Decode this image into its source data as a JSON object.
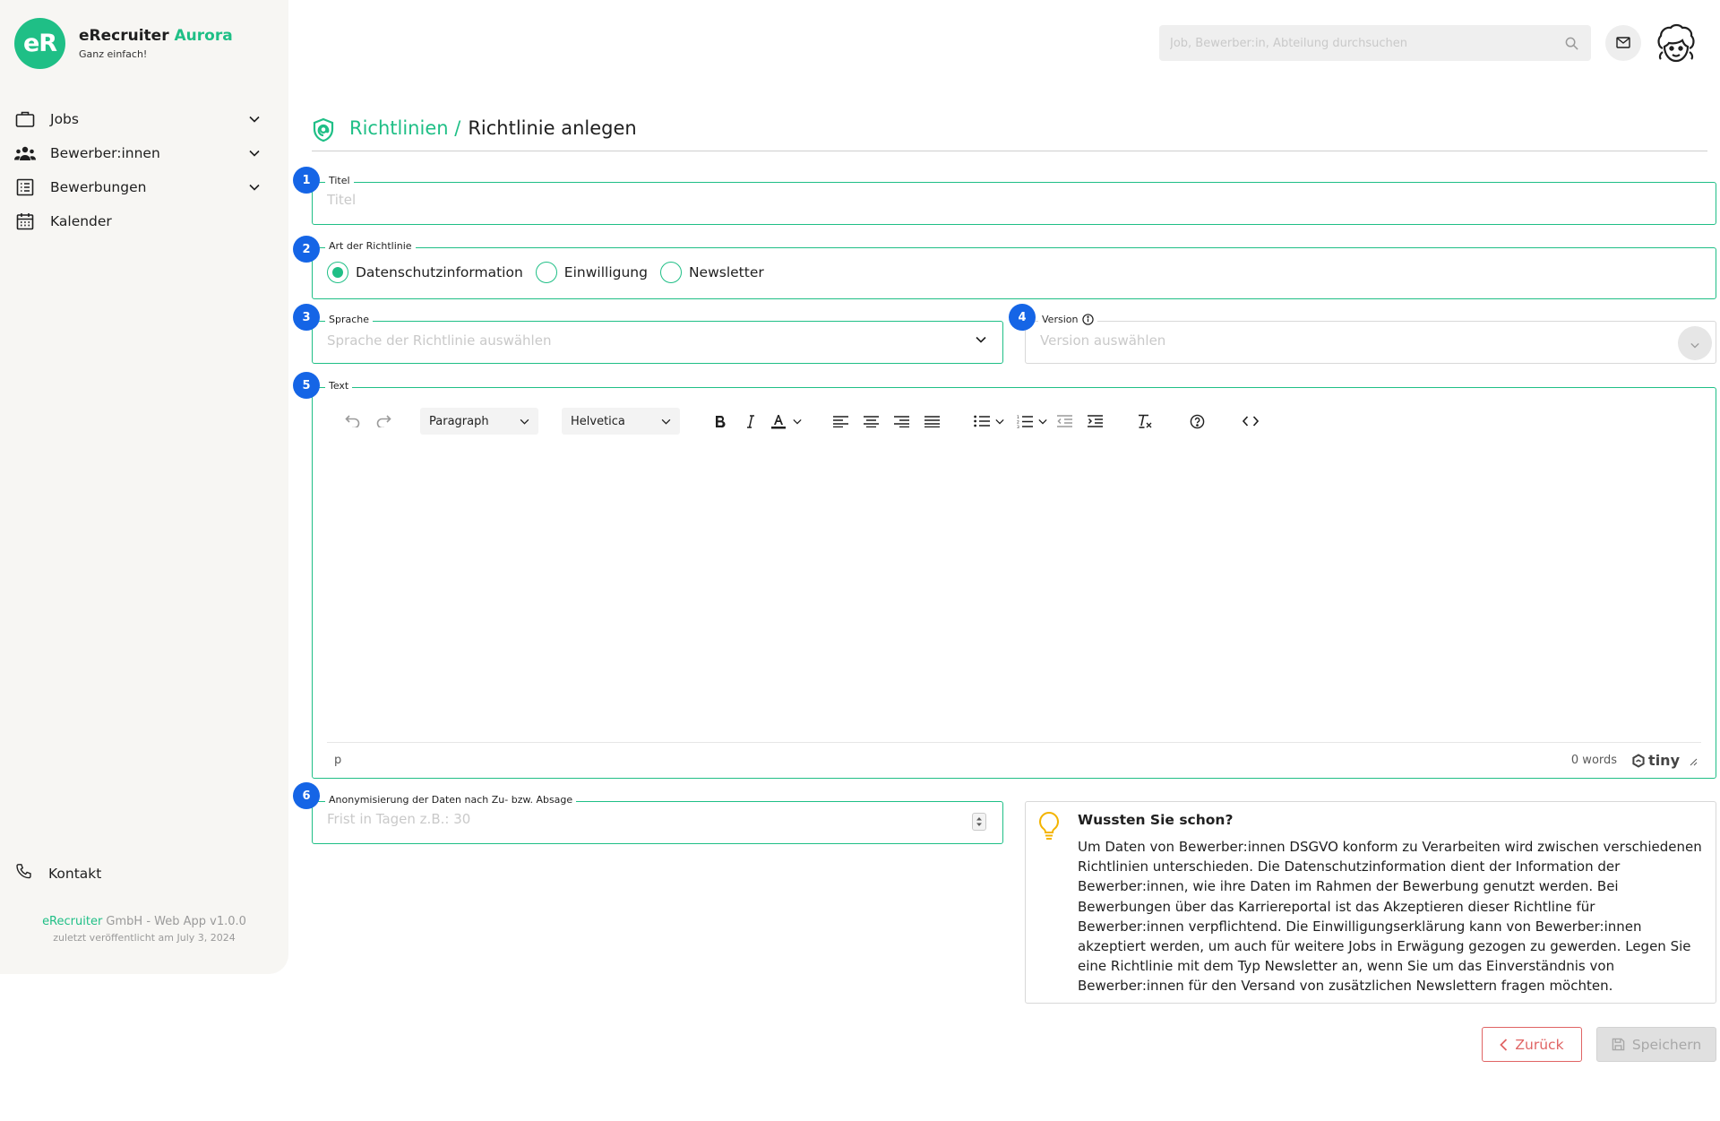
{
  "brand": {
    "logo_text": "eR",
    "name": "eRecruiter",
    "name_accent": "Aurora",
    "tagline": "Ganz einfach!"
  },
  "sidebar": {
    "items": [
      {
        "label": "Jobs",
        "icon": "briefcase-icon",
        "has_chevron": true
      },
      {
        "label": "Bewerber:innen",
        "icon": "people-icon",
        "has_chevron": true
      },
      {
        "label": "Bewerbungen",
        "icon": "list-icon",
        "has_chevron": true
      },
      {
        "label": "Kalender",
        "icon": "calendar-icon",
        "has_chevron": false
      }
    ],
    "contact_label": "Kontakt",
    "footer_brand": "eRecruiter",
    "footer_rest": " GmbH - Web App v1.0.0",
    "footer_published": "zuletzt veröffentlicht am July 3, 2024"
  },
  "topbar": {
    "search_placeholder": "Job, Bewerber:in, Abteilung durchsuchen"
  },
  "header": {
    "breadcrumb": "Richtlinien /",
    "title": "Richtlinie anlegen"
  },
  "form": {
    "titel": {
      "badge": "1",
      "legend": "Titel",
      "placeholder": "Titel",
      "value": ""
    },
    "art": {
      "badge": "2",
      "legend": "Art der Richtlinie",
      "options": [
        {
          "label": "Datenschutzinformation",
          "selected": true
        },
        {
          "label": "Einwilligung",
          "selected": false
        },
        {
          "label": "Newsletter",
          "selected": false
        }
      ]
    },
    "sprache": {
      "badge": "3",
      "legend": "Sprache",
      "placeholder": "Sprache der Richtlinie auswählen"
    },
    "version": {
      "badge": "4",
      "legend": "Version",
      "placeholder": "Version auswählen"
    },
    "text": {
      "badge": "5",
      "legend": "Text",
      "block_format": "Paragraph",
      "font_family": "Helvetica",
      "status_path": "p",
      "word_count": "0 words",
      "brand": "tiny"
    },
    "anonymisierung": {
      "badge": "6",
      "legend": "Anonymisierung der Daten nach Zu- bzw. Absage",
      "placeholder": "Frist in Tagen z.B.: 30"
    }
  },
  "info": {
    "title": "Wussten Sie schon?",
    "text": "Um Daten von Bewerber:innen DSGVO konform zu Verarbeiten wird zwischen verschiedenen Richtlinien unterschieden. Die Datenschutzinformation dient der Information der Bewerber:innen, wie ihre Daten im Rahmen der Bewerbung genutzt werden. Bei Bewerbungen über das Karriereportal ist das Akzeptieren dieser Richtline für Bewerber:innen verpflichtend. Die Einwilligungserklärung kann von Bewerber:innen akzeptiert werden, um auch für weitere Jobs in Erwägung gezogen zu gewerden. Legen Sie eine Richtlinie mit dem Typ Newsletter an, wenn Sie um das Einverständnis von Bewerber:innen für den Versand von zusätzlichen Newslettern fragen möchten."
  },
  "actions": {
    "back_label": "Zurück",
    "save_label": "Speichern"
  },
  "colors": {
    "accent": "#1fbf86",
    "badge": "#1565e6",
    "danger": "#e06464",
    "disabled": "#e0e0e0"
  }
}
